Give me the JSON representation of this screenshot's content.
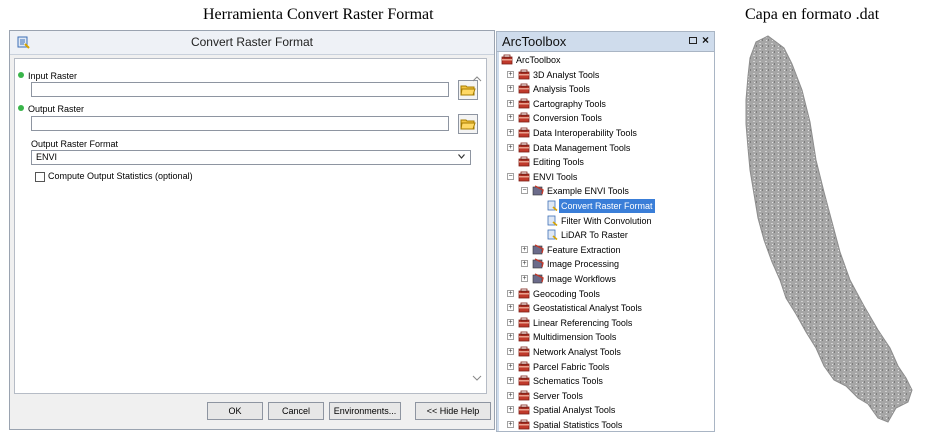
{
  "captions": {
    "left": "Herramienta Convert Raster Format",
    "right": "Capa en formato .dat"
  },
  "dialog": {
    "title": "Convert Raster Format",
    "input_raster_label": "Input Raster",
    "input_raster_value": "",
    "output_raster_label": "Output Raster",
    "output_raster_value": "",
    "output_format_label": "Output Raster Format",
    "output_format_value": "ENVI",
    "stats_label": "Compute Output Statistics (optional)",
    "stats_checked": false,
    "buttons": {
      "ok": "OK",
      "cancel": "Cancel",
      "environments": "Environments...",
      "hide_help": "<< Hide Help"
    }
  },
  "toolbox": {
    "title": "ArcToolbox",
    "close": "×",
    "tree": [
      {
        "label": "ArcToolbox",
        "level": 0,
        "icon": "arctoolbox-icon",
        "expander": "none"
      },
      {
        "label": "3D Analyst Tools",
        "level": 1,
        "icon": "toolbox-icon",
        "expander": "plus"
      },
      {
        "label": "Analysis Tools",
        "level": 1,
        "icon": "toolbox-icon",
        "expander": "plus"
      },
      {
        "label": "Cartography Tools",
        "level": 1,
        "icon": "toolbox-icon",
        "expander": "plus"
      },
      {
        "label": "Conversion Tools",
        "level": 1,
        "icon": "toolbox-icon",
        "expander": "plus"
      },
      {
        "label": "Data Interoperability Tools",
        "level": 1,
        "icon": "toolbox-icon",
        "expander": "plus"
      },
      {
        "label": "Data Management Tools",
        "level": 1,
        "icon": "toolbox-icon",
        "expander": "plus"
      },
      {
        "label": "Editing Tools",
        "level": 1,
        "icon": "toolbox-icon",
        "expander": "none"
      },
      {
        "label": "ENVI Tools",
        "level": 1,
        "icon": "toolbox-icon",
        "expander": "minus"
      },
      {
        "label": "Example ENVI Tools",
        "level": 2,
        "icon": "toolset-icon",
        "expander": "minus"
      },
      {
        "label": "Convert Raster Format",
        "level": 3,
        "icon": "tool-icon",
        "expander": "none",
        "selected": true
      },
      {
        "label": "Filter With Convolution",
        "level": 3,
        "icon": "tool-icon",
        "expander": "none"
      },
      {
        "label": "LiDAR To Raster",
        "level": 3,
        "icon": "tool-icon",
        "expander": "none"
      },
      {
        "label": "Feature Extraction",
        "level": 2,
        "icon": "toolset-icon",
        "expander": "plus"
      },
      {
        "label": "Image Processing",
        "level": 2,
        "icon": "toolset-icon",
        "expander": "plus"
      },
      {
        "label": "Image Workflows",
        "level": 2,
        "icon": "toolset-icon",
        "expander": "plus"
      },
      {
        "label": "Geocoding Tools",
        "level": 1,
        "icon": "toolbox-icon",
        "expander": "plus"
      },
      {
        "label": "Geostatistical Analyst Tools",
        "level": 1,
        "icon": "toolbox-icon",
        "expander": "plus"
      },
      {
        "label": "Linear Referencing Tools",
        "level": 1,
        "icon": "toolbox-icon",
        "expander": "plus"
      },
      {
        "label": "Multidimension Tools",
        "level": 1,
        "icon": "toolbox-icon",
        "expander": "plus"
      },
      {
        "label": "Network Analyst Tools",
        "level": 1,
        "icon": "toolbox-icon",
        "expander": "plus"
      },
      {
        "label": "Parcel Fabric Tools",
        "level": 1,
        "icon": "toolbox-icon",
        "expander": "plus"
      },
      {
        "label": "Schematics Tools",
        "level": 1,
        "icon": "toolbox-icon",
        "expander": "plus"
      },
      {
        "label": "Server Tools",
        "level": 1,
        "icon": "toolbox-icon",
        "expander": "plus"
      },
      {
        "label": "Spatial Analyst Tools",
        "level": 1,
        "icon": "toolbox-icon",
        "expander": "plus"
      },
      {
        "label": "Spatial Statistics Tools",
        "level": 1,
        "icon": "toolbox-icon",
        "expander": "plus"
      }
    ]
  },
  "colors": {
    "selection": "#3a7ed8",
    "toolbox_red": "#c0392b",
    "required_dot": "#39b54a",
    "raster_gray": "#9a9a9a"
  }
}
